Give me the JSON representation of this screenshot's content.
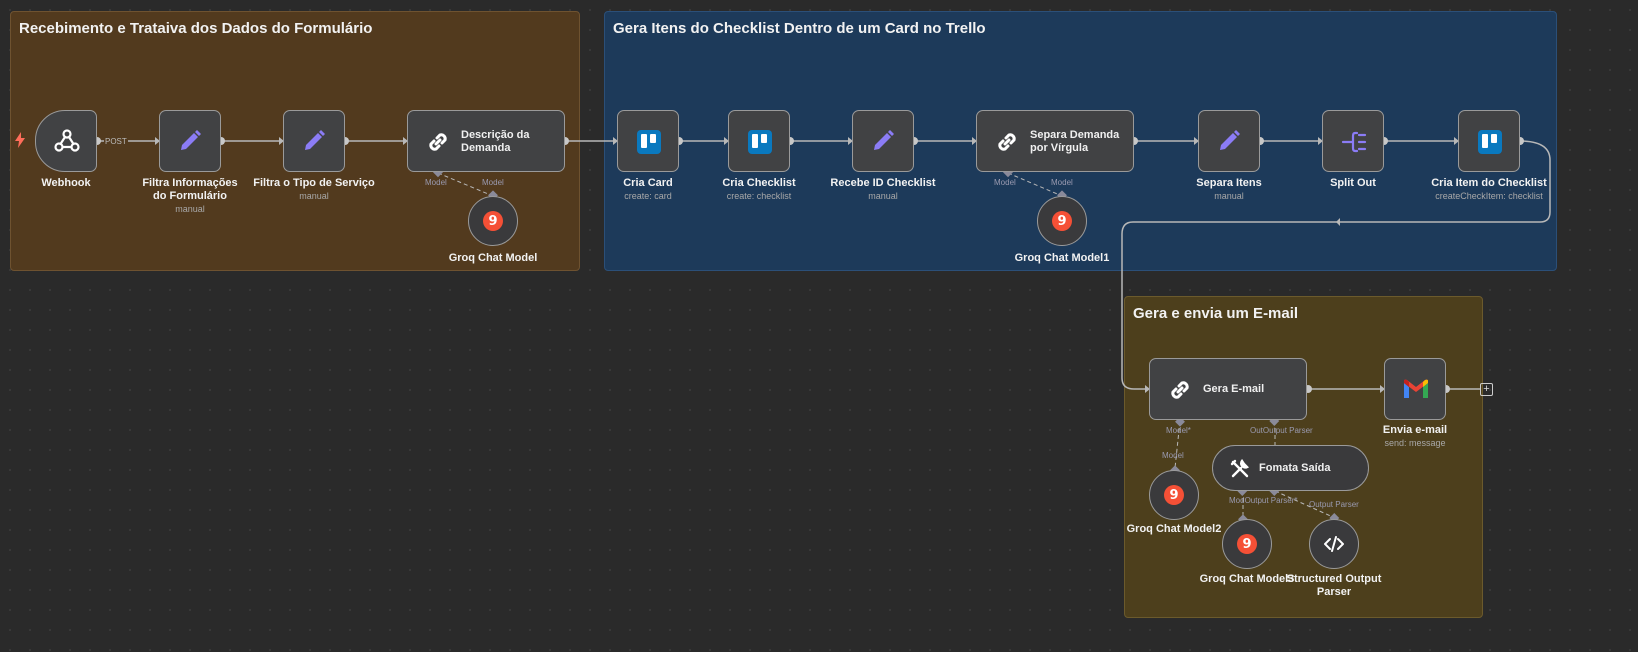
{
  "stickies": {
    "s1": {
      "title": "Recebimento e Trataiva dos Dados do Formulário"
    },
    "s2": {
      "title": "Gera Itens do Checklist Dentro de um Card no Trello"
    },
    "s3": {
      "title": "Gera e envia um E-mail"
    }
  },
  "nodes": {
    "webhook": {
      "label": "Webhook",
      "icon": "webhook-icon"
    },
    "filtra_info": {
      "label": "Filtra Informações do Formulário",
      "sub": "manual",
      "icon": "pencil-icon"
    },
    "filtra_tipo": {
      "label": "Filtra o Tipo de Serviço",
      "sub": "manual",
      "icon": "pencil-icon"
    },
    "descricao": {
      "label": "Descrição da Demanda",
      "icon": "chain-link-icon"
    },
    "groq1": {
      "label": "Groq Chat Model"
    },
    "cria_card": {
      "label": "Cria Card",
      "sub": "create: card",
      "icon": "trello-icon"
    },
    "cria_checklist": {
      "label": "Cria Checklist",
      "sub": "create: checklist",
      "icon": "trello-icon"
    },
    "recebe_id": {
      "label": "Recebe ID Checklist",
      "sub": "manual",
      "icon": "pencil-icon"
    },
    "separa_demanda": {
      "label": "Separa Demanda por Vírgula",
      "icon": "chain-link-icon"
    },
    "groq2": {
      "label": "Groq Chat Model1"
    },
    "separa_itens": {
      "label": "Separa Itens",
      "sub": "manual",
      "icon": "pencil-icon"
    },
    "split_out": {
      "label": "Split Out",
      "icon": "split-icon"
    },
    "cria_item": {
      "label": "Cria Item do Checklist",
      "sub": "createCheckItem: checklist",
      "icon": "trello-icon"
    },
    "gera_email": {
      "label": "Gera E-mail",
      "icon": "chain-link-icon"
    },
    "envia_email": {
      "label": "Envia e-mail",
      "sub": "send: message",
      "icon": "gmail-icon"
    },
    "fomata_saida": {
      "label": "Fomata Saída",
      "icon": "tools-icon"
    },
    "groq3": {
      "label": "Groq Chat Model2"
    },
    "groq4": {
      "label": "Groq Chat Model3"
    },
    "structured": {
      "label": "Structured Output Parser",
      "icon": "code-icon"
    }
  },
  "edge_labels": {
    "post": "POST",
    "model": "Model",
    "model_req": "Model*",
    "output_parser": "Output Parser",
    "output_parser_req": "Output Parser*",
    "out_output_parser": "OutOutput Parser",
    "mod_output_parser": "ModOutput Parser*"
  },
  "colors": {
    "canvas": "#2a2a2a",
    "sticky_brown": "#523a1e",
    "sticky_blue": "#1d3a5a",
    "sticky_olive": "#4d3f1c",
    "node_bg": "#414244",
    "wire": "#b8b8b8",
    "purple_icon": "#8b7cf6",
    "trigger": "#ff6d5a"
  }
}
